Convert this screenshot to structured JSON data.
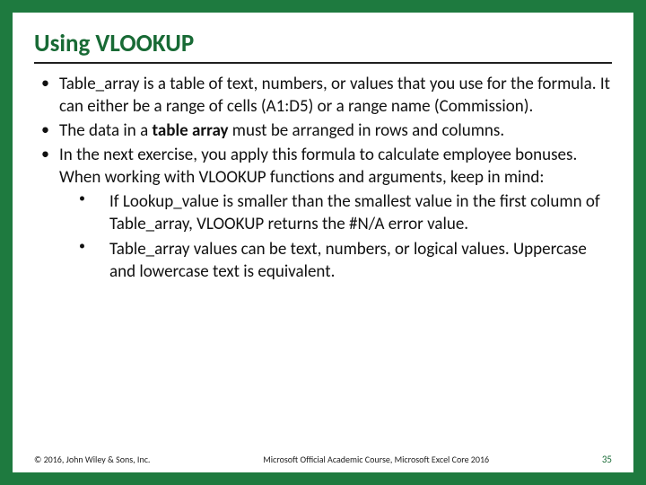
{
  "title": "Using VLOOKUP",
  "bullets": {
    "b1": "Table_array is a table of text, numbers, or values that you use for the formula. It can either be a range of cells (A1:D5) or a range name (Commission).",
    "b2_pre": "The data in a ",
    "b2_bold": "table array",
    "b2_post": " must be arranged in rows and columns.",
    "b3": "In the next exercise, you apply this formula to calculate employee bonuses. When working with VLOOKUP functions and arguments, keep in mind:",
    "sub1": "If Lookup_value is smaller than the smallest value in the first column of Table_array, VLOOKUP returns the #N/A error value.",
    "sub2": "Table_array values can be text, numbers, or logical values. Uppercase and lowercase text is equivalent."
  },
  "footer": {
    "left": "© 2016, John Wiley & Sons, Inc.",
    "center": "Microsoft Official Academic Course, Microsoft Excel Core 2016",
    "right": "35"
  }
}
